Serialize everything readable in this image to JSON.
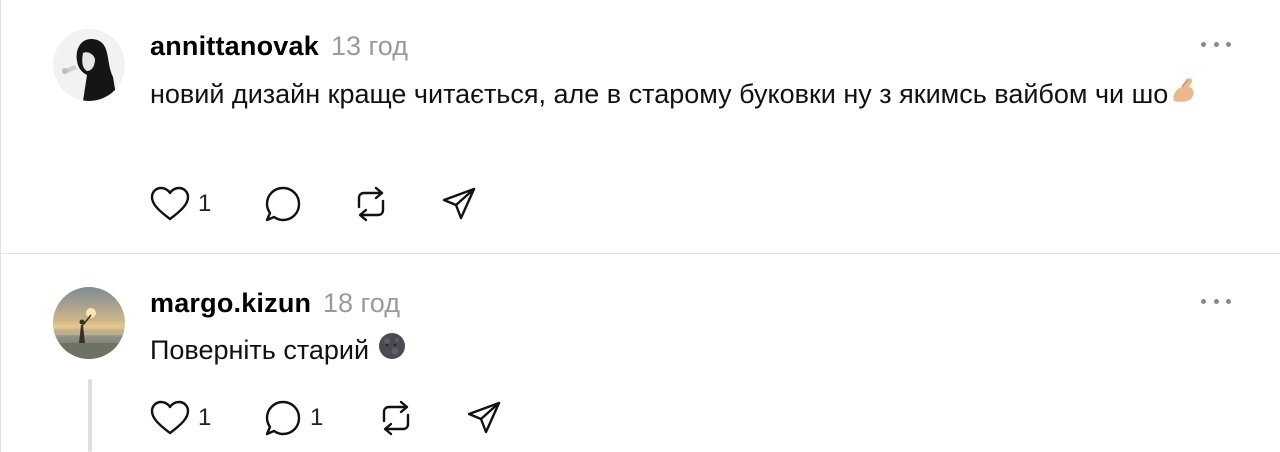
{
  "comments": [
    {
      "username": "annittanovak",
      "time": "13 год",
      "text": "новий дизайн краще читається, але в старому буковки ну з якимсь вайбом чи шо",
      "emoji": "pinched-fingers-emoji",
      "likes": "1",
      "replies": "",
      "icons": [
        "heart-icon",
        "comment-icon",
        "repost-icon",
        "share-icon",
        "more-icon"
      ]
    },
    {
      "username": "margo.kizun",
      "time": "18 год",
      "text": "Поверніть старий",
      "emoji": "new-moon-face-emoji",
      "likes": "1",
      "replies": "1",
      "icons": [
        "heart-icon",
        "comment-icon",
        "repost-icon",
        "share-icon",
        "more-icon"
      ]
    }
  ]
}
